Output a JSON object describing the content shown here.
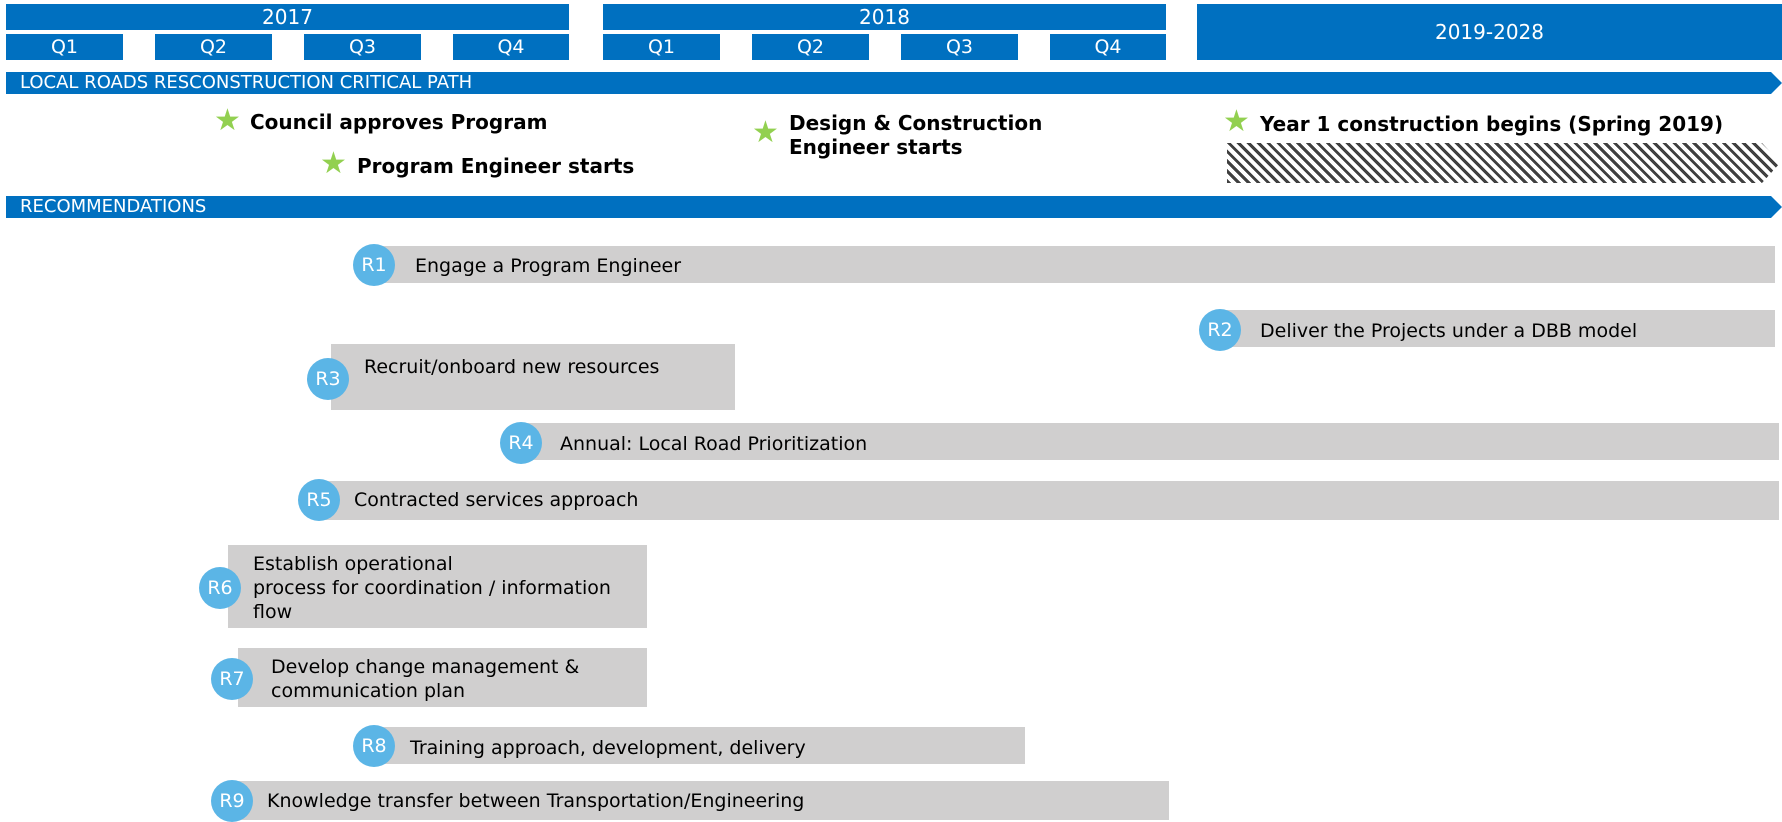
{
  "header": {
    "year1": "2017",
    "year2": "2018",
    "future": "2019-2028",
    "quarters": [
      "Q1",
      "Q2",
      "Q3",
      "Q4",
      "Q1",
      "Q2",
      "Q3",
      "Q4"
    ]
  },
  "sections": {
    "critical_path": "LOCAL ROADS RESCONSTRUCTION CRITICAL PATH",
    "recommendations": "RECOMMENDATIONS"
  },
  "milestones": {
    "m1": "Council approves Program",
    "m2": "Program Engineer starts",
    "m3_line1": "Design & Construction",
    "m3_line2": "Engineer starts",
    "m4": "Year 1 construction begins (Spring 2019)"
  },
  "recommendations": [
    {
      "id": "R1",
      "label": "Engage a Program Engineer"
    },
    {
      "id": "R2",
      "label": "Deliver the Projects under a DBB model"
    },
    {
      "id": "R3",
      "label": "Recruit/onboard new resources"
    },
    {
      "id": "R4",
      "label": "Annual: Local Road Prioritization"
    },
    {
      "id": "R5",
      "label": "Contracted services approach"
    },
    {
      "id": "R6",
      "label_line1": "Establish operational",
      "label_line2": "process for coordination / information",
      "label_line3": "flow"
    },
    {
      "id": "R7",
      "label_line1": "Develop change management &",
      "label_line2": "communication plan"
    },
    {
      "id": "R8",
      "label": "Training approach, development, delivery"
    },
    {
      "id": "R9",
      "label": "Knowledge transfer between Transportation/Engineering"
    }
  ],
  "colors": {
    "header": "#0070c0",
    "bar": "#d0cfcf",
    "badge": "#5bb5e6",
    "star": "#92d050"
  },
  "icons": {
    "milestone": "star-icon"
  }
}
